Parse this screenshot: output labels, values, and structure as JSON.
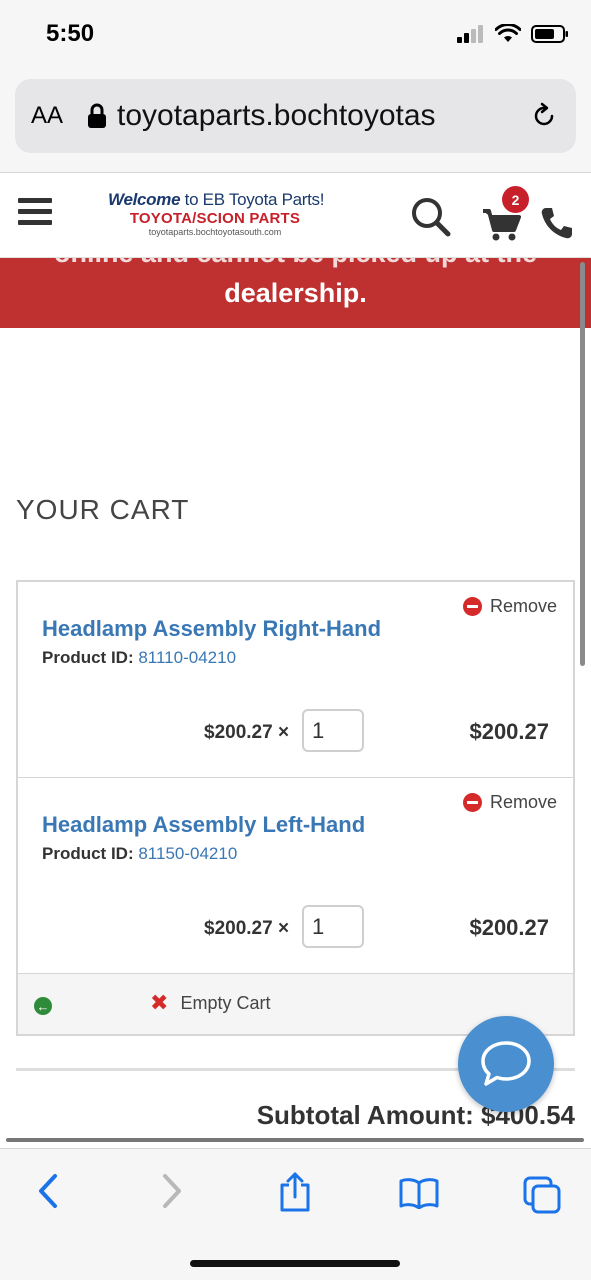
{
  "status": {
    "time": "5:50"
  },
  "browser": {
    "aa_label": "AA",
    "url": "toyotaparts.bochtoyotas",
    "toolbar": {
      "back": "back-icon",
      "forward": "forward-icon",
      "share": "share-icon",
      "bookmarks": "bookmarks-icon",
      "tabs": "tabs-icon"
    }
  },
  "site": {
    "logo": {
      "welcome": "Welcome",
      "to_text": "to EB Toyota Parts!",
      "brand_a": "TOYOTA/",
      "brand_b": "SCION PARTS",
      "domain": "toyotaparts.bochtoyotasouth.com"
    },
    "cart_count": "2",
    "banner": {
      "partial_line": "online and cannot be picked up at the",
      "line": "dealership."
    }
  },
  "cart": {
    "title": "YOUR CART",
    "remove_label": "Remove",
    "product_id_label": "Product ID:",
    "items": [
      {
        "name": "Headlamp Assembly Right-Hand",
        "product_id": "81110-04210",
        "unit_price": "$200.27",
        "times": "×",
        "qty": "1",
        "total": "$200.27"
      },
      {
        "name": "Headlamp Assembly Left-Hand",
        "product_id": "81150-04210",
        "unit_price": "$200.27",
        "times": "×",
        "qty": "1",
        "total": "$200.27"
      }
    ],
    "empty_cart_label": "Empty Cart",
    "subtotal": "Subtotal Amount: $400.54"
  },
  "colors": {
    "banner_red": "#bf3030",
    "link_blue": "#3a78b5",
    "chat_blue": "#4a90d0",
    "ios_blue": "#1a73e8"
  }
}
